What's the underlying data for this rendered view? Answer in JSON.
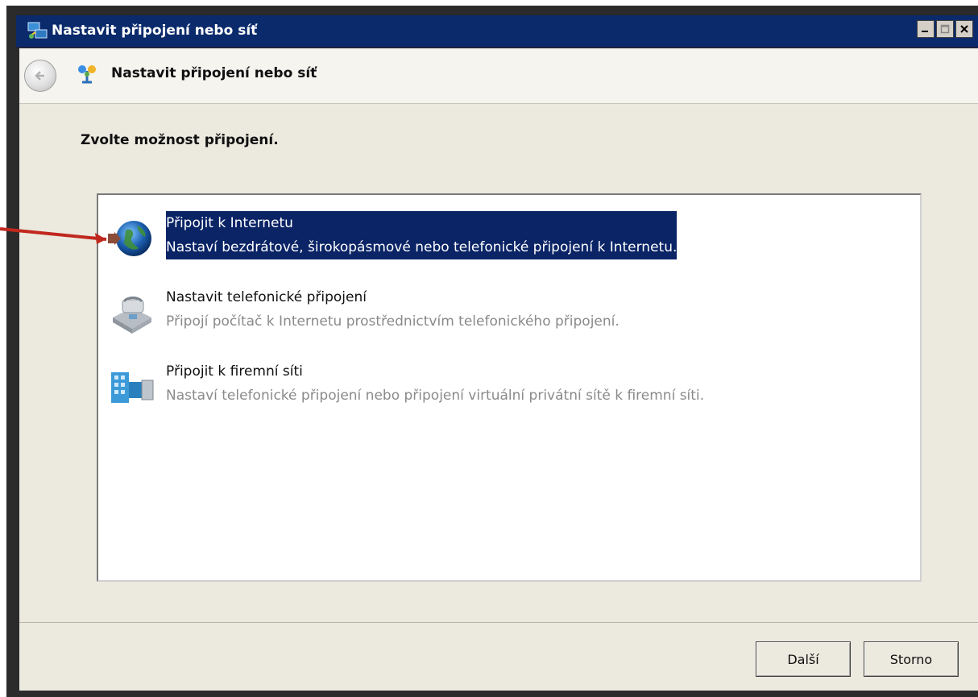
{
  "window": {
    "title": "Nastavit připojení nebo síť"
  },
  "nav": {
    "title": "Nastavit připojení nebo síť"
  },
  "main": {
    "prompt": "Zvolte možnost připojení."
  },
  "options": [
    {
      "title": "Připojit k Internetu",
      "description": "Nastaví bezdrátové, širokopásmové nebo telefonické připojení k Internetu.",
      "icon": "globe-icon",
      "selected": true
    },
    {
      "title": "Nastavit telefonické připojení",
      "description": "Připojí počítač k Internetu prostřednictvím telefonického připojení.",
      "icon": "phone-icon",
      "selected": false
    },
    {
      "title": "Připojit k firemní síti",
      "description": "Nastaví telefonické připojení nebo připojení virtuální privátní sítě k firemní síti.",
      "icon": "corporate-network-icon",
      "selected": false
    }
  ],
  "buttons": {
    "next": "Další",
    "cancel": "Storno"
  },
  "colors": {
    "titlebar": "#0a2a6b",
    "selection": "#0a2466",
    "annotation_arrow": "#c0281e"
  }
}
